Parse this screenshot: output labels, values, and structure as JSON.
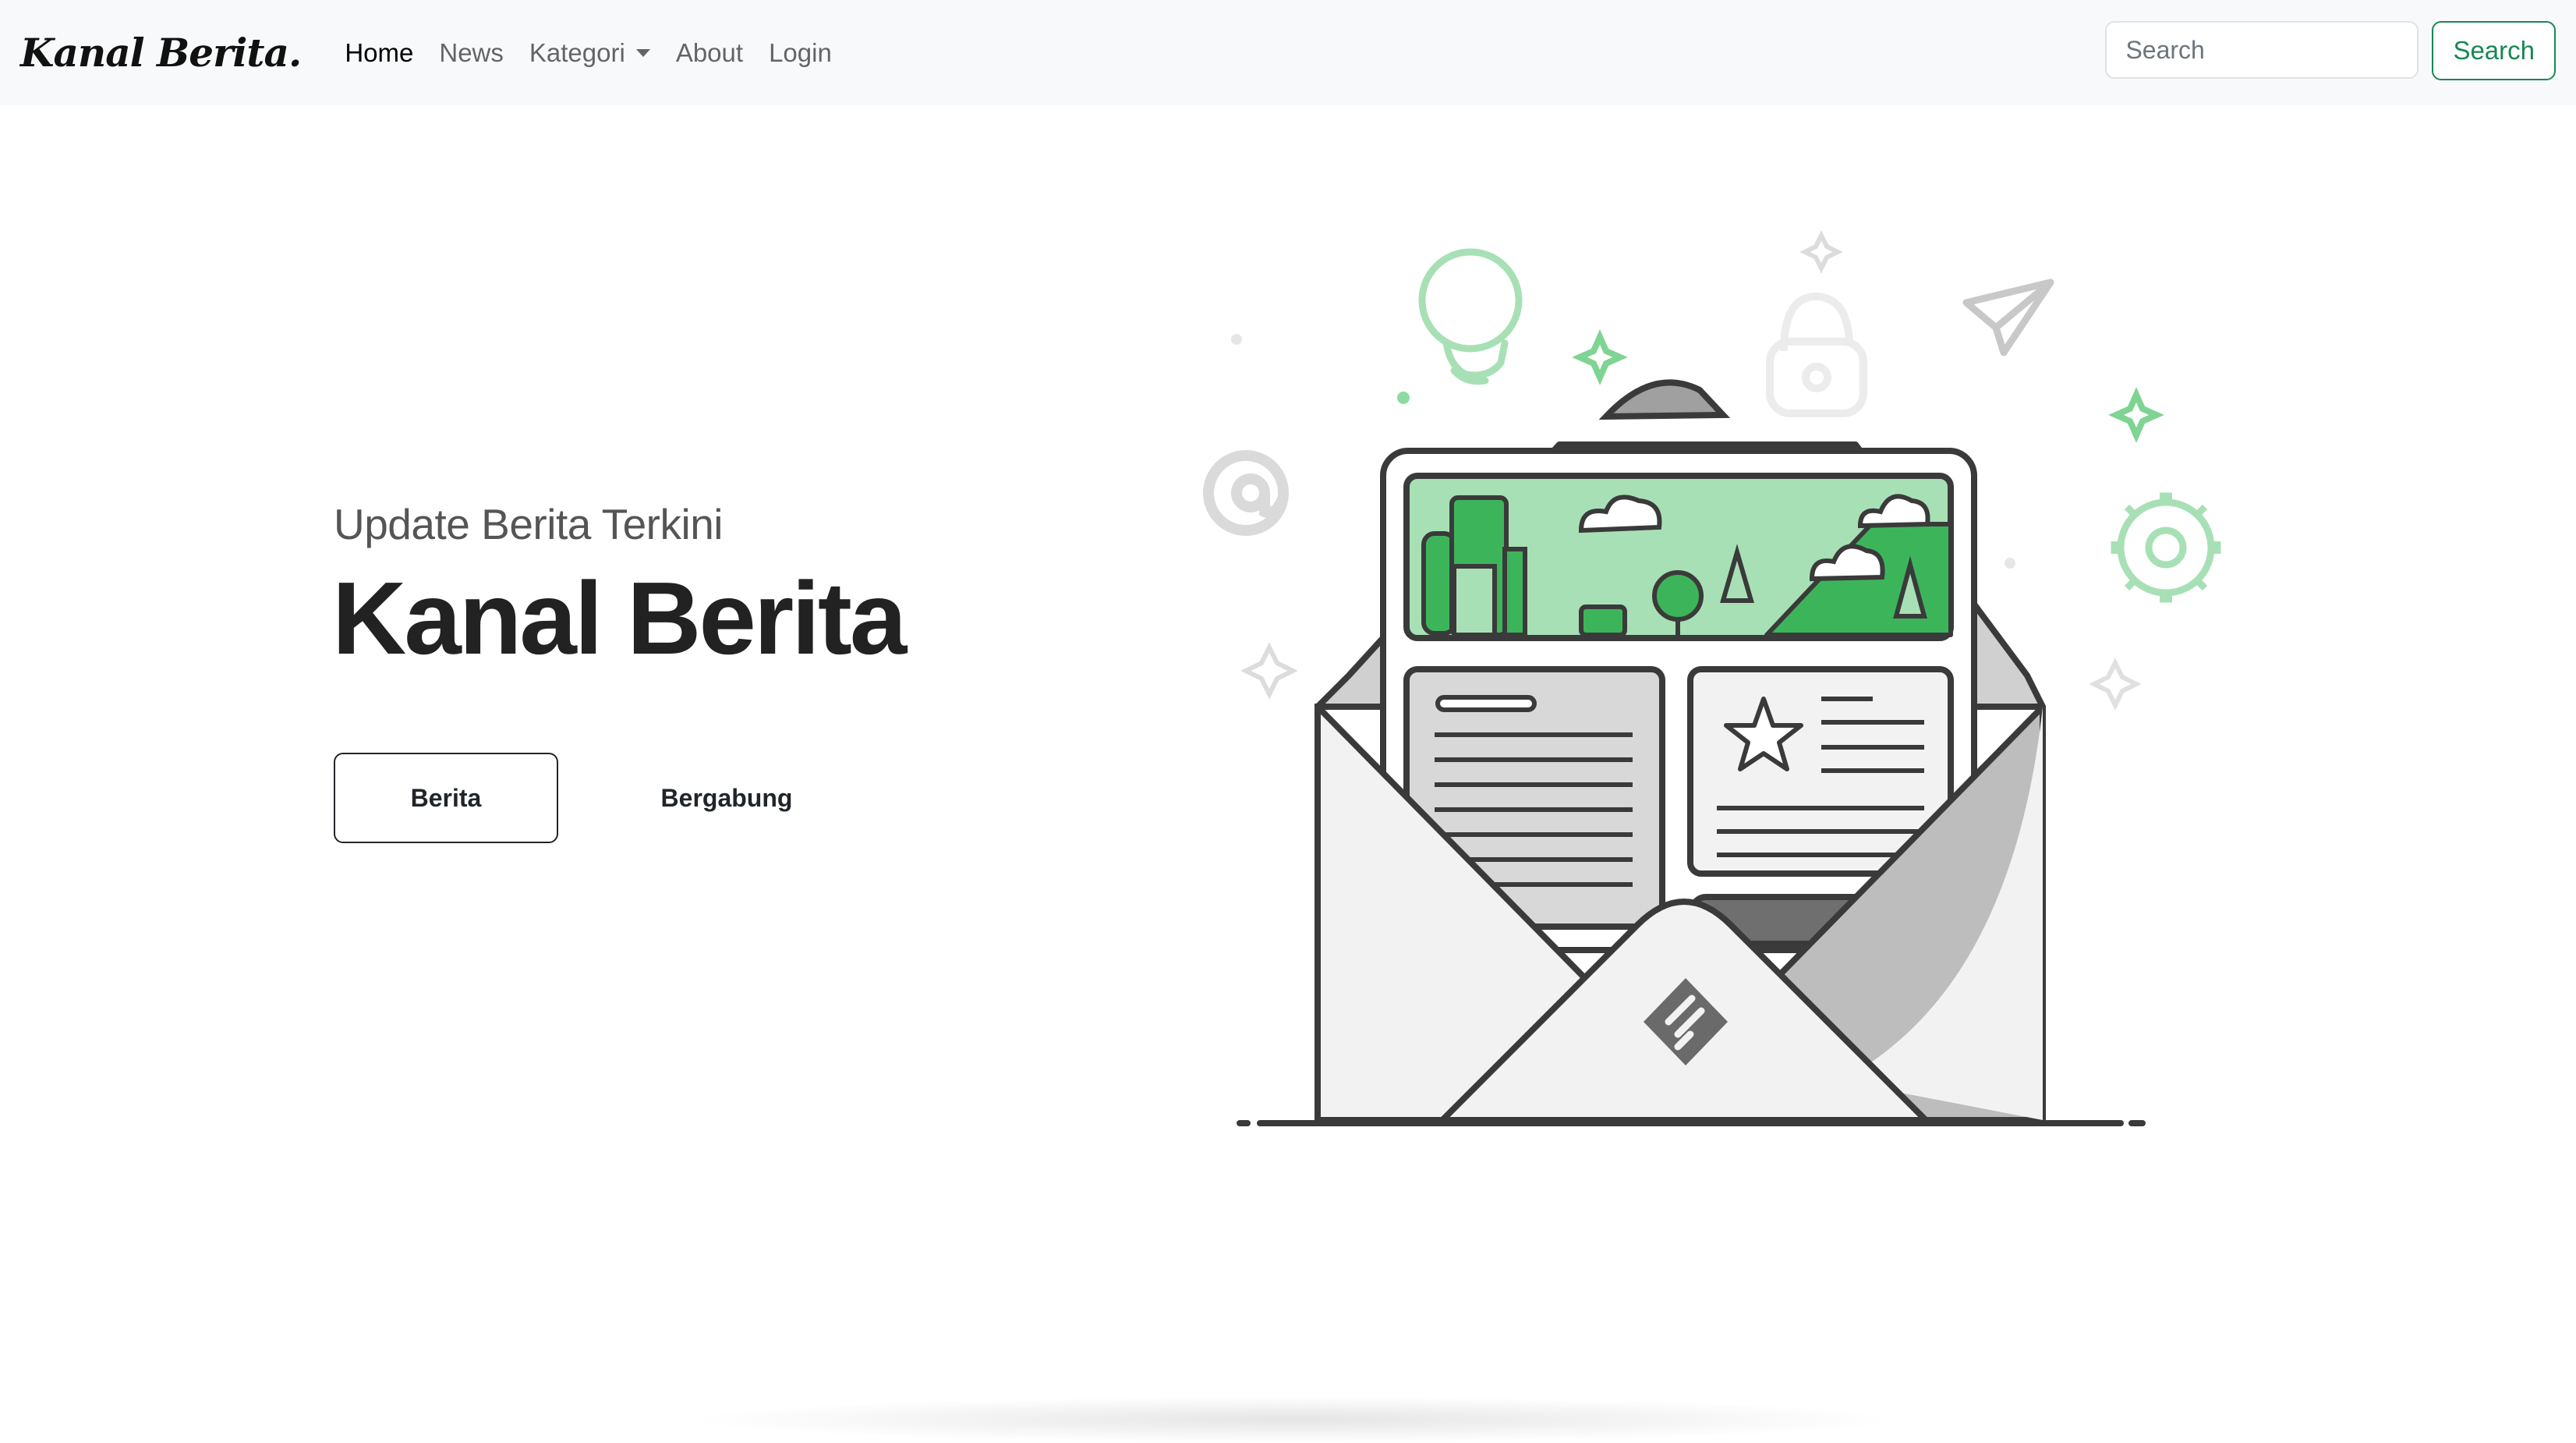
{
  "navbar": {
    "brand": "Kanal Berita.",
    "links": [
      {
        "label": "Home",
        "active": true
      },
      {
        "label": "News"
      },
      {
        "label": "Kategori",
        "dropdown": true
      },
      {
        "label": "About"
      },
      {
        "label": "Login"
      }
    ],
    "search": {
      "placeholder": "Search",
      "value": "",
      "button_label": "Search"
    }
  },
  "hero": {
    "subtitle": "Update Berita Terkini",
    "title": "Kanal Berita",
    "primary_button": "Berita",
    "secondary_button": "Bergabung"
  },
  "colors": {
    "accent": "#198754",
    "illustration_green": "#3cb55a",
    "illustration_light_green": "#a8e0b5"
  },
  "icons": [
    "chevron-down-icon",
    "newsletter-envelope-illustration"
  ]
}
